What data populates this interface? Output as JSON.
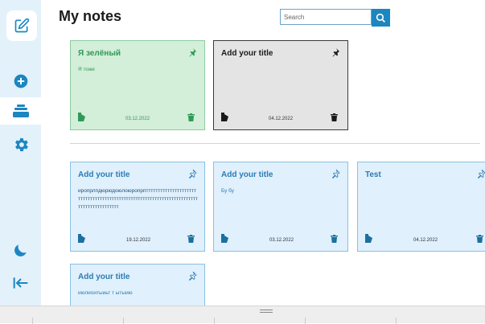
{
  "page": {
    "title": "My notes"
  },
  "search": {
    "placeholder": "Search"
  },
  "sidebar": {
    "items": [
      {
        "name": "add-note",
        "icon": "plus-circle-icon"
      },
      {
        "name": "notes",
        "icon": "stack-icon",
        "active": true
      },
      {
        "name": "settings",
        "icon": "gear-icon"
      },
      {
        "name": "theme",
        "icon": "moon-icon"
      },
      {
        "name": "collapse",
        "icon": "collapse-left-icon"
      }
    ]
  },
  "pinned_notes": [
    {
      "title": "Я зелёный",
      "text": "Я тоже",
      "date": "03.12.2022",
      "color": "green",
      "pinned": true
    },
    {
      "title": "Add your title",
      "text": "",
      "date": "04.12.2022",
      "color": "gray",
      "pinned": true
    }
  ],
  "notes": [
    {
      "title": "Add your title",
      "text": "иропрлпдюрюдоюлоюропрптттттттттттттттттттттттттттттттттттттттттттттттттттттттттттттттттттттттттттттттттттттттт",
      "date": "19.12.2022",
      "color": "blue",
      "pinned": false
    },
    {
      "title": "Add your title",
      "text": "Бу бу",
      "date": "03.12.2022",
      "color": "blue",
      "pinned": false
    },
    {
      "title": "Test",
      "text": "",
      "date": "04.12.2022",
      "color": "blue",
      "pinned": false
    },
    {
      "title": "Add your title",
      "text": "июлиоитыиьт т ытыию",
      "date": "",
      "color": "blue",
      "pinned": false
    }
  ],
  "colors": {
    "accent": "#1c86c0",
    "sidebar_bg": "#e3f1fb",
    "green_card": "#d3eed9",
    "gray_card": "#e4e4e4",
    "blue_card": "#e0f0fc"
  }
}
